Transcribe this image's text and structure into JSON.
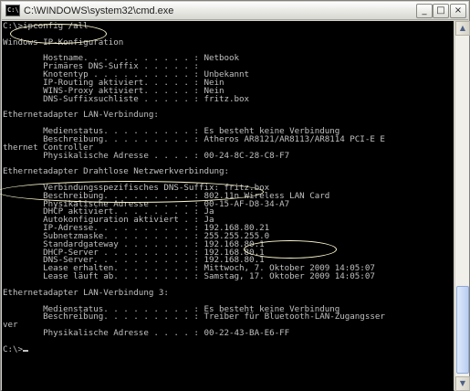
{
  "window": {
    "title": "C:\\WINDOWS\\system32\\cmd.exe",
    "icon_label": "C:\\",
    "controls": {
      "minimize": "_",
      "maximize": "□",
      "close": "×"
    }
  },
  "console": {
    "lines": [
      "C:\\>ipconfig /all",
      "",
      "Windows-IP-Konfiguration",
      "",
      "        Hostname. . . . . . . . . . . : Netbook",
      "        Primäres DNS-Suffix . . . . . :",
      "        Knotentyp . . . . . . . . . . : Unbekannt",
      "        IP-Routing aktiviert. . . . . : Nein",
      "        WINS-Proxy aktiviert. . . . . : Nein",
      "        DNS-Suffixsuchliste . . . . . : fritz.box",
      "",
      "Ethernetadapter LAN-Verbindung:",
      "",
      "        Medienstatus. . . . . . . . . : Es besteht keine Verbindung",
      "        Beschreibung. . . . . . . . . : Atheros AR8121/AR8113/AR8114 PCI-E E",
      "thernet Controller",
      "        Physikalische Adresse . . . . : 00-24-8C-28-C8-F7",
      "",
      "Ethernetadapter Drahtlose Netzwerkverbindung:",
      "",
      "        Verbindungsspezifisches DNS-Suffix: fritz.box",
      "        Beschreibung. . . . . . . . . : 802.11n Wireless LAN Card",
      "        Physikalische Adresse . . . . : 00-15-AF-D8-34-A7",
      "        DHCP aktiviert. . . . . . . . : Ja",
      "        Autokonfiguration aktiviert . : Ja",
      "        IP-Adresse. . . . . . . . . . : 192.168.80.21",
      "        Subnetzmaske. . . . . . . . . : 255.255.255.0",
      "        Standardgateway . . . . . . . : 192.168.80.1",
      "        DHCP-Server . . . . . . . . . : 192.168.80.1",
      "        DNS-Server. . . . . . . . . . : 192.168.80.1",
      "        Lease erhalten. . . . . . . . : Mittwoch, 7. Oktober 2009 14:05:07",
      "        Lease läuft ab. . . . . . . . : Samstag, 17. Oktober 2009 14:05:07",
      "",
      "Ethernetadapter LAN-Verbindung 3:",
      "",
      "        Medienstatus. . . . . . . . . : Es besteht keine Verbindung",
      "        Beschreibung. . . . . . . . . : Treiber für Bluetooth-LAN-Zugangsser",
      "ver",
      "        Physikalische Adresse . . . . : 00-22-43-BA-E6-FF",
      "",
      "C:\\>"
    ]
  },
  "scrollbar": {
    "up_arrow": "▲",
    "down_arrow": "▼"
  },
  "colors": {
    "console_bg": "#000000",
    "console_text": "#c0c0c0",
    "highlight_ellipse": "#fffad0"
  }
}
